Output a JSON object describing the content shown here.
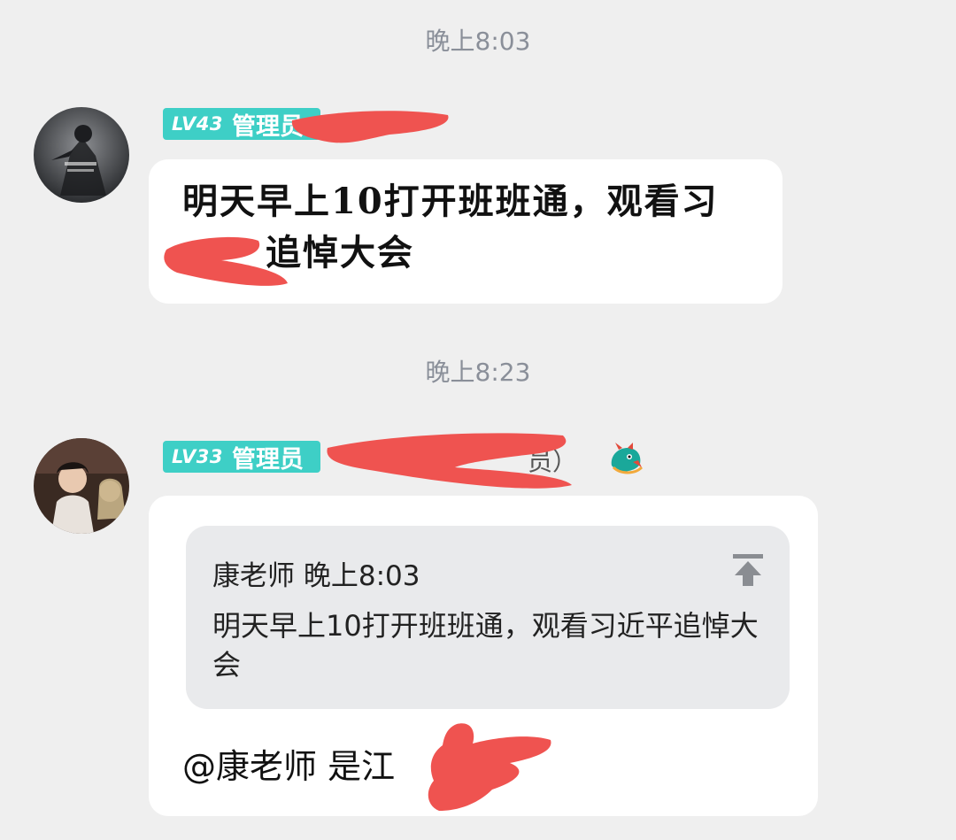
{
  "timestamps": [
    "晚上8:03",
    "晚上8:23"
  ],
  "message1": {
    "level": "LV43",
    "role": "管理员",
    "text_line1": "明天早上10打开班班通，观看习",
    "text_line2": "追悼大会"
  },
  "message2": {
    "level": "LV33",
    "role": "管理员",
    "name_suffix": "员）",
    "emblem_icon": "dragon-emblem-icon",
    "quote": {
      "author": "康老师",
      "time": "晚上8:03",
      "text": "明天早上10打开班班通，观看习近平追悼大会"
    },
    "reply_text": "@康老师 是江"
  },
  "colors": {
    "background": "#efefef",
    "badge": "#3ecfc6",
    "redaction": "#ef5350",
    "timestamp": "#8a8f99"
  }
}
